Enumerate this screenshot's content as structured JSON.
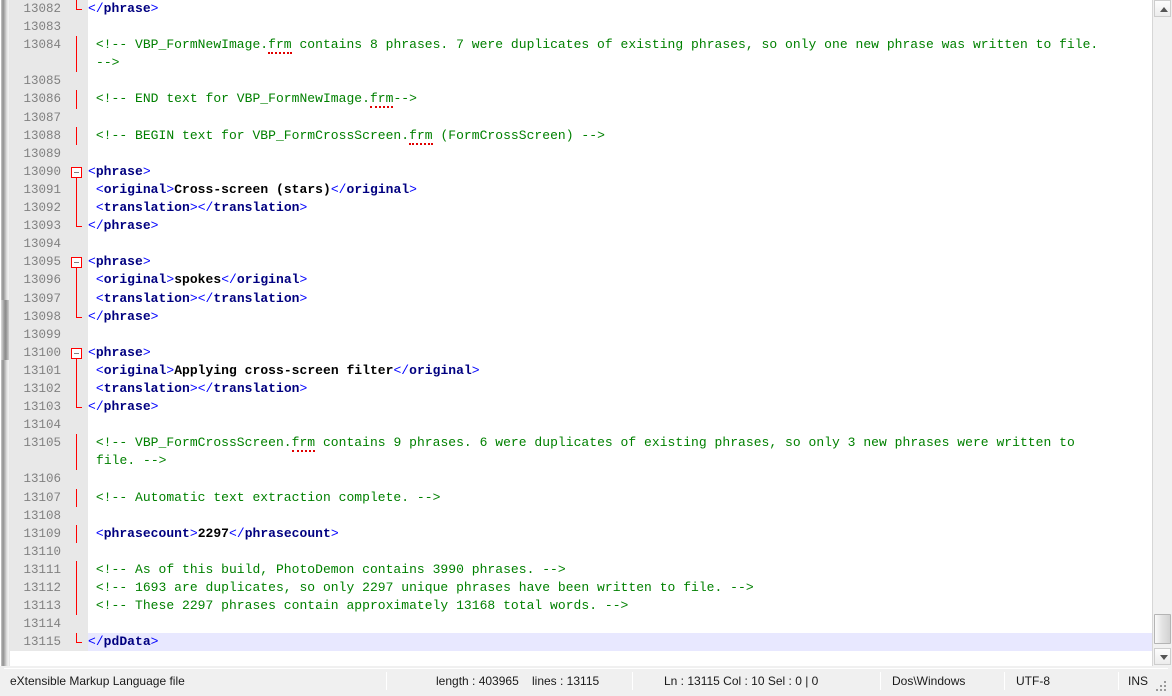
{
  "app": {
    "editor": "Notepad++",
    "doc_type": "eXtensible Markup Language file"
  },
  "colors": {
    "comment": "#008000",
    "tag_bracket": "#0000ff",
    "tag_name": "#000080",
    "text_content": "#000000",
    "gutter_bg": "#e8e8e8",
    "line_number": "#808080",
    "current_line_bg": "#e8e8ff",
    "fold_marker": "#ff0000",
    "editor_bg": "#ffffff"
  },
  "editor": {
    "first_visible_line": 13082,
    "last_visible_line": 13115,
    "word_wrap": true,
    "current_line": 13115,
    "lines": [
      {
        "n": "13082",
        "fold": "end",
        "parts": [
          {
            "t": "tagbr",
            "s": "</"
          },
          {
            "t": "tagnm",
            "s": "phrase"
          },
          {
            "t": "tagbr",
            "s": ">"
          }
        ]
      },
      {
        "n": "13083",
        "fold": "none",
        "parts": []
      },
      {
        "n": "13084",
        "fold": "line",
        "parts": [
          {
            "t": "cmt",
            "s": "<!-- VBP_FormNewImage."
          },
          {
            "t": "cmt",
            "s": "frm",
            "sp": true
          },
          {
            "t": "cmt",
            "s": " contains 8 phrases. 7 were duplicates of existing phrases, so only one new phrase was written to file."
          }
        ]
      },
      {
        "n": "",
        "fold": "line",
        "wrap": true,
        "parts": [
          {
            "t": "cmt",
            "s": "-->"
          }
        ]
      },
      {
        "n": "13085",
        "fold": "none",
        "parts": []
      },
      {
        "n": "13086",
        "fold": "line",
        "parts": [
          {
            "t": "cmt",
            "s": "<!-- END text for VBP_FormNewImage."
          },
          {
            "t": "cmt",
            "s": "frm",
            "sp": true
          },
          {
            "t": "cmt",
            "s": "-->"
          }
        ]
      },
      {
        "n": "13087",
        "fold": "none",
        "parts": []
      },
      {
        "n": "13088",
        "fold": "line",
        "parts": [
          {
            "t": "cmt",
            "s": "<!-- BEGIN text for VBP_FormCrossScreen."
          },
          {
            "t": "cmt",
            "s": "frm",
            "sp": true
          },
          {
            "t": "cmt",
            "s": " (FormCrossScreen) -->"
          }
        ]
      },
      {
        "n": "13089",
        "fold": "none",
        "parts": []
      },
      {
        "n": "13090",
        "fold": "open",
        "parts": [
          {
            "t": "tagbr",
            "s": "<"
          },
          {
            "t": "tagnm",
            "s": "phrase"
          },
          {
            "t": "tagbr",
            "s": ">"
          }
        ]
      },
      {
        "n": "13091",
        "fold": "line",
        "indent": true,
        "parts": [
          {
            "t": "tagbr",
            "s": "<"
          },
          {
            "t": "tagnm",
            "s": "original"
          },
          {
            "t": "tagbr",
            "s": ">"
          },
          {
            "t": "txt",
            "s": "Cross-screen (stars)"
          },
          {
            "t": "tagbr",
            "s": "</"
          },
          {
            "t": "tagnm",
            "s": "original"
          },
          {
            "t": "tagbr",
            "s": ">"
          }
        ]
      },
      {
        "n": "13092",
        "fold": "line",
        "indent": true,
        "parts": [
          {
            "t": "tagbr",
            "s": "<"
          },
          {
            "t": "tagnm",
            "s": "translation"
          },
          {
            "t": "tagbr",
            "s": ">"
          },
          {
            "t": "tagbr",
            "s": "</"
          },
          {
            "t": "tagnm",
            "s": "translation"
          },
          {
            "t": "tagbr",
            "s": ">"
          }
        ]
      },
      {
        "n": "13093",
        "fold": "end",
        "parts": [
          {
            "t": "tagbr",
            "s": "</"
          },
          {
            "t": "tagnm",
            "s": "phrase"
          },
          {
            "t": "tagbr",
            "s": ">"
          }
        ]
      },
      {
        "n": "13094",
        "fold": "none",
        "parts": []
      },
      {
        "n": "13095",
        "fold": "open",
        "parts": [
          {
            "t": "tagbr",
            "s": "<"
          },
          {
            "t": "tagnm",
            "s": "phrase"
          },
          {
            "t": "tagbr",
            "s": ">"
          }
        ]
      },
      {
        "n": "13096",
        "fold": "line",
        "indent": true,
        "parts": [
          {
            "t": "tagbr",
            "s": "<"
          },
          {
            "t": "tagnm",
            "s": "original"
          },
          {
            "t": "tagbr",
            "s": ">"
          },
          {
            "t": "txt",
            "s": "spokes"
          },
          {
            "t": "tagbr",
            "s": "</"
          },
          {
            "t": "tagnm",
            "s": "original"
          },
          {
            "t": "tagbr",
            "s": ">"
          }
        ]
      },
      {
        "n": "13097",
        "fold": "line",
        "indent": true,
        "parts": [
          {
            "t": "tagbr",
            "s": "<"
          },
          {
            "t": "tagnm",
            "s": "translation"
          },
          {
            "t": "tagbr",
            "s": ">"
          },
          {
            "t": "tagbr",
            "s": "</"
          },
          {
            "t": "tagnm",
            "s": "translation"
          },
          {
            "t": "tagbr",
            "s": ">"
          }
        ]
      },
      {
        "n": "13098",
        "fold": "end",
        "parts": [
          {
            "t": "tagbr",
            "s": "</"
          },
          {
            "t": "tagnm",
            "s": "phrase"
          },
          {
            "t": "tagbr",
            "s": ">"
          }
        ]
      },
      {
        "n": "13099",
        "fold": "none",
        "parts": []
      },
      {
        "n": "13100",
        "fold": "open",
        "parts": [
          {
            "t": "tagbr",
            "s": "<"
          },
          {
            "t": "tagnm",
            "s": "phrase"
          },
          {
            "t": "tagbr",
            "s": ">"
          }
        ]
      },
      {
        "n": "13101",
        "fold": "line",
        "indent": true,
        "parts": [
          {
            "t": "tagbr",
            "s": "<"
          },
          {
            "t": "tagnm",
            "s": "original"
          },
          {
            "t": "tagbr",
            "s": ">"
          },
          {
            "t": "txt",
            "s": "Applying cross-screen filter"
          },
          {
            "t": "tagbr",
            "s": "</"
          },
          {
            "t": "tagnm",
            "s": "original"
          },
          {
            "t": "tagbr",
            "s": ">"
          }
        ]
      },
      {
        "n": "13102",
        "fold": "line",
        "indent": true,
        "parts": [
          {
            "t": "tagbr",
            "s": "<"
          },
          {
            "t": "tagnm",
            "s": "translation"
          },
          {
            "t": "tagbr",
            "s": ">"
          },
          {
            "t": "tagbr",
            "s": "</"
          },
          {
            "t": "tagnm",
            "s": "translation"
          },
          {
            "t": "tagbr",
            "s": ">"
          }
        ]
      },
      {
        "n": "13103",
        "fold": "end",
        "parts": [
          {
            "t": "tagbr",
            "s": "</"
          },
          {
            "t": "tagnm",
            "s": "phrase"
          },
          {
            "t": "tagbr",
            "s": ">"
          }
        ]
      },
      {
        "n": "13104",
        "fold": "none",
        "parts": []
      },
      {
        "n": "13105",
        "fold": "line",
        "parts": [
          {
            "t": "cmt",
            "s": "<!-- VBP_FormCrossScreen."
          },
          {
            "t": "cmt",
            "s": "frm",
            "sp": true
          },
          {
            "t": "cmt",
            "s": " contains 9 phrases. 6 were duplicates of existing phrases, so only 3 new phrases were written to"
          }
        ]
      },
      {
        "n": "",
        "fold": "line",
        "wrap": true,
        "parts": [
          {
            "t": "cmt",
            "s": "file. -->"
          }
        ]
      },
      {
        "n": "13106",
        "fold": "none",
        "parts": []
      },
      {
        "n": "13107",
        "fold": "line",
        "parts": [
          {
            "t": "cmt",
            "s": "<!-- Automatic text extraction complete. -->"
          }
        ]
      },
      {
        "n": "13108",
        "fold": "none",
        "parts": []
      },
      {
        "n": "13109",
        "fold": "line",
        "parts": [
          {
            "t": "tagbr",
            "s": "<"
          },
          {
            "t": "tagnm",
            "s": "phrasecount"
          },
          {
            "t": "tagbr",
            "s": ">"
          },
          {
            "t": "txt",
            "s": "2297"
          },
          {
            "t": "tagbr",
            "s": "</"
          },
          {
            "t": "tagnm",
            "s": "phrasecount"
          },
          {
            "t": "tagbr",
            "s": ">"
          }
        ]
      },
      {
        "n": "13110",
        "fold": "none",
        "parts": []
      },
      {
        "n": "13111",
        "fold": "line",
        "parts": [
          {
            "t": "cmt",
            "s": "<!-- As of this build, PhotoDemon contains 3990 phrases. -->"
          }
        ]
      },
      {
        "n": "13112",
        "fold": "line",
        "parts": [
          {
            "t": "cmt",
            "s": "<!-- 1693 are duplicates, so only 2297 unique phrases have been written to file. -->"
          }
        ]
      },
      {
        "n": "13113",
        "fold": "line",
        "parts": [
          {
            "t": "cmt",
            "s": "<!-- These 2297 phrases contain approximately 13168 total words. -->"
          }
        ]
      },
      {
        "n": "13114",
        "fold": "none",
        "parts": []
      },
      {
        "n": "13115",
        "fold": "end",
        "current": true,
        "parts": [
          {
            "t": "tagbr",
            "s": "</"
          },
          {
            "t": "tagnm",
            "s": "pdData"
          },
          {
            "t": "tagbr",
            "s": ">"
          }
        ]
      }
    ]
  },
  "statusbar": {
    "doc_type": "eXtensible Markup Language file",
    "length_label": "length : 403965",
    "lines_label": "lines : 13115",
    "position": "Ln : 13115   Col : 10   Sel : 0 | 0",
    "eol": "Dos\\Windows",
    "encoding": "UTF-8",
    "insert_mode": "INS"
  },
  "scrollbar": {
    "vertical_position": "bottom",
    "up_arrow": "scroll-up-arrow",
    "down_arrow": "scroll-down-arrow"
  }
}
